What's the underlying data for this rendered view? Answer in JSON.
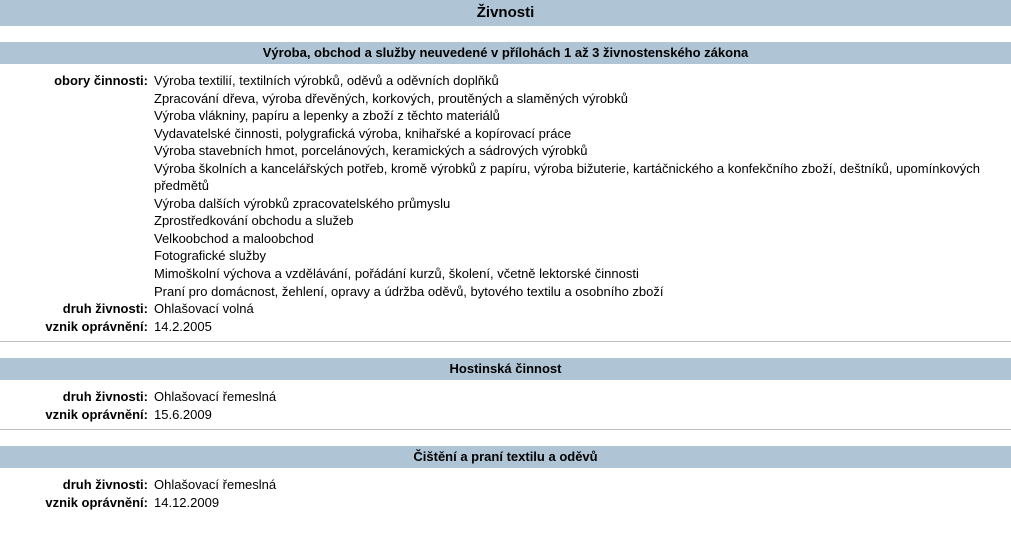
{
  "title": "Živnosti",
  "labels": {
    "obory": "obory činnosti:",
    "druh": "druh živnosti:",
    "vznik": "vznik oprávnění:"
  },
  "sections": [
    {
      "heading": "Výroba, obchod a služby neuvedené v přílohách 1 až 3 živnostenského zákona",
      "activities": [
        "Výroba textilií, textilních výrobků, oděvů a oděvních doplňků",
        "Zpracování dřeva, výroba dřevěných, korkových, proutěných a slaměných výrobků",
        "Výroba vlákniny, papíru a lepenky a zboží z těchto materiálů",
        "Vydavatelské činnosti, polygrafická výroba, knihařské a kopírovací práce",
        "Výroba stavebních hmot, porcelánových, keramických a sádrových výrobků",
        "Výroba školních a kancelářských potřeb, kromě výrobků z papíru, výroba bižuterie, kartáčnického a konfekčního zboží, deštníků, upomínkových předmětů",
        "Výroba dalších výrobků zpracovatelského průmyslu",
        "Zprostředkování obchodu a služeb",
        "Velkoobchod a maloobchod",
        "Fotografické služby",
        "Mimoškolní výchova a vzdělávání, pořádání kurzů, školení, včetně lektorské činnosti",
        "Praní pro domácnost, žehlení, opravy a údržba oděvů, bytového textilu a osobního zboží"
      ],
      "druh": "Ohlašovací volná",
      "vznik": "14.2.2005"
    },
    {
      "heading": "Hostinská činnost",
      "druh": "Ohlašovací řemeslná",
      "vznik": "15.6.2009"
    },
    {
      "heading": "Čištění a praní textilu a oděvů",
      "druh": "Ohlašovací řemeslná",
      "vznik": "14.12.2009"
    }
  ]
}
